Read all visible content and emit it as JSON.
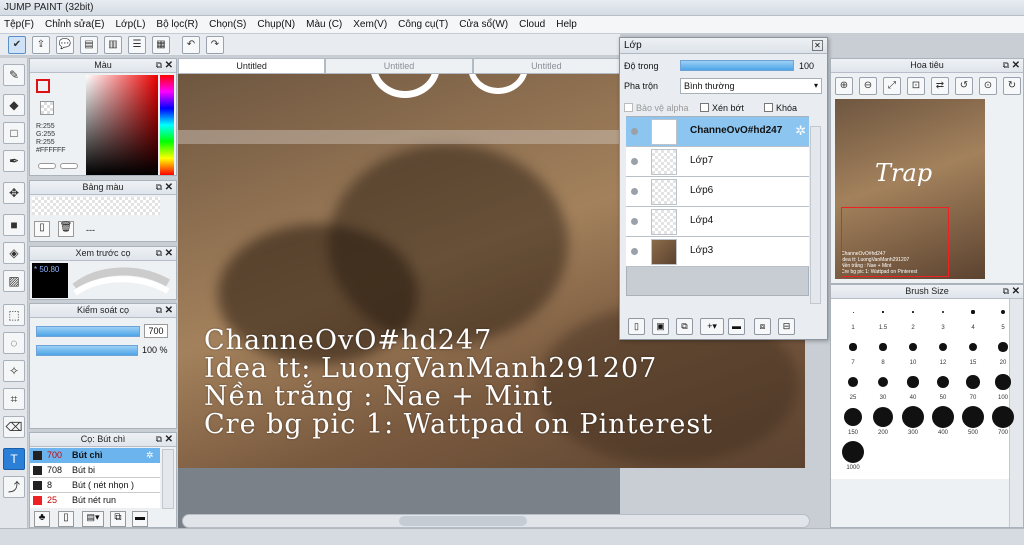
{
  "window": {
    "title": "JUMP PAINT (32bit)"
  },
  "menu": [
    "Tệp(F)",
    "Chỉnh sửa(E)",
    "Lớp(L)",
    "Bộ lọc(R)",
    "Chọn(S)",
    "Chụp(N)",
    "Màu (C)",
    "Xem(V)",
    "Công cụ(T)",
    "Cửa sổ(W)",
    "Cloud",
    "Help"
  ],
  "tabs": [
    "Untitled",
    "Untitled",
    "Untitled"
  ],
  "color_panel": {
    "title": "Màu",
    "rgb": [
      "R:255",
      "G:255",
      "R:255"
    ],
    "hex": "#FFFFFF"
  },
  "palette_panel": {
    "title": "Bảng màu",
    "value": "---"
  },
  "preview_panel": {
    "title": "Xem trước cọ",
    "value": "* 50.80"
  },
  "brush_control": {
    "title": "Kiểm soát cọ",
    "size": "700",
    "opacity": "100 %"
  },
  "brush_list": {
    "title": "Cọ: Bút chì",
    "items": [
      {
        "size": "700",
        "name": "Bút chì"
      },
      {
        "size": "708",
        "name": "Bút bi"
      },
      {
        "size": "8",
        "name": "Bút ( nét nhọn )"
      },
      {
        "size": "25",
        "name": "Bút nét run"
      }
    ]
  },
  "canvas_text": [
    "ChanneOvO#hd247",
    "Idea tt: LuongVanManh291207",
    "Nền trắng : Nae + Mint",
    "Cre bg pic 1: Wattpad on Pinterest"
  ],
  "layer_panel": {
    "title": "Lớp",
    "opacity_label": "Độ trong",
    "opacity_value": "100 %",
    "blend_label": "Pha trộn",
    "blend_value": "Bình thường",
    "protect_alpha": "Bảo vệ alpha",
    "clipping": "Xén bớt",
    "lock": "Khóa",
    "layers": [
      "ChanneOvO#hd247",
      "Lớp7",
      "Lớp6",
      "Lớp4",
      "Lớp3"
    ]
  },
  "navigator": {
    "title": "Hoa tiêu",
    "thumb_title": "Trap",
    "thumb_caption": [
      "ChanneOvO#hd247",
      "Idea tt: LuongVanManh291207",
      "Nền trắng : Nae + Mint",
      "Cre bg pic 1: Wattpad on Pinterest"
    ]
  },
  "brush_size": {
    "title": "Brush Size",
    "sizes": [
      "1",
      "1.5",
      "2",
      "3",
      "4",
      "5",
      "7",
      "8",
      "10",
      "12",
      "15",
      "20",
      "25",
      "30",
      "40",
      "50",
      "70",
      "100",
      "150",
      "200",
      "300",
      "400",
      "500",
      "700",
      "1000"
    ]
  }
}
